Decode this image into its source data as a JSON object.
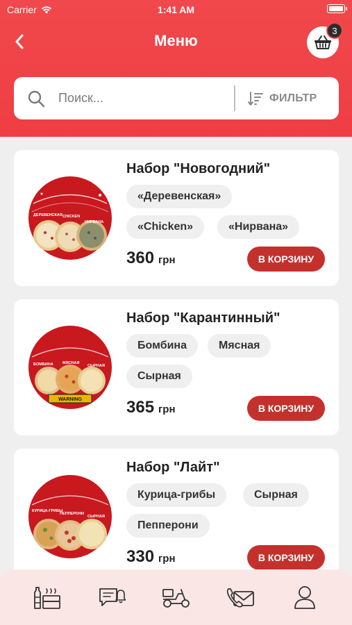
{
  "status_bar": {
    "carrier": "Carrier",
    "time": "1:41 AM"
  },
  "header": {
    "title": "Меню",
    "cart_count": "3"
  },
  "search": {
    "placeholder": "Поиск...",
    "filter_label": "ФИЛЬТР"
  },
  "products": [
    {
      "title": "Набор \"Новогодний\"",
      "tags": [
        "«Деревенская»",
        "«Chicken»",
        "«Нирвана»"
      ],
      "price": "360",
      "currency": "грн",
      "button": "В КОРЗИНУ",
      "image_labels": [
        "ДЕРЕВЕНСКАЯ",
        "CHICKEN",
        "НИРВАНА"
      ]
    },
    {
      "title": "Набор \"Карантинный\"",
      "tags": [
        "Бомбина",
        "Мясная",
        "Сырная"
      ],
      "price": "365",
      "currency": "грн",
      "button": "В КОРЗИНУ",
      "image_labels": [
        "БОМБИНА",
        "МЯСНАЯ",
        "СЫРНАЯ",
        "WARNING"
      ]
    },
    {
      "title": "Набор \"Лайт\"",
      "tags": [
        "Курица-грибы",
        "Сырная",
        "Пепперони"
      ],
      "price": "330",
      "currency": "грн",
      "button": "В КОРЗИНУ",
      "image_labels": [
        "КУРИЦА-ГРИБЫ",
        "ПЕППЕРОНИ",
        "СЫРНАЯ"
      ]
    }
  ],
  "tab_bar": {
    "icons": [
      "menu-icon",
      "chat-notification-icon",
      "delivery-scooter-icon",
      "phone-mail-icon",
      "profile-icon"
    ]
  },
  "colors": {
    "header": "#ef3e43",
    "button": "#c4312d",
    "tab_bar": "#fbe6e6",
    "chip": "#efefef"
  }
}
